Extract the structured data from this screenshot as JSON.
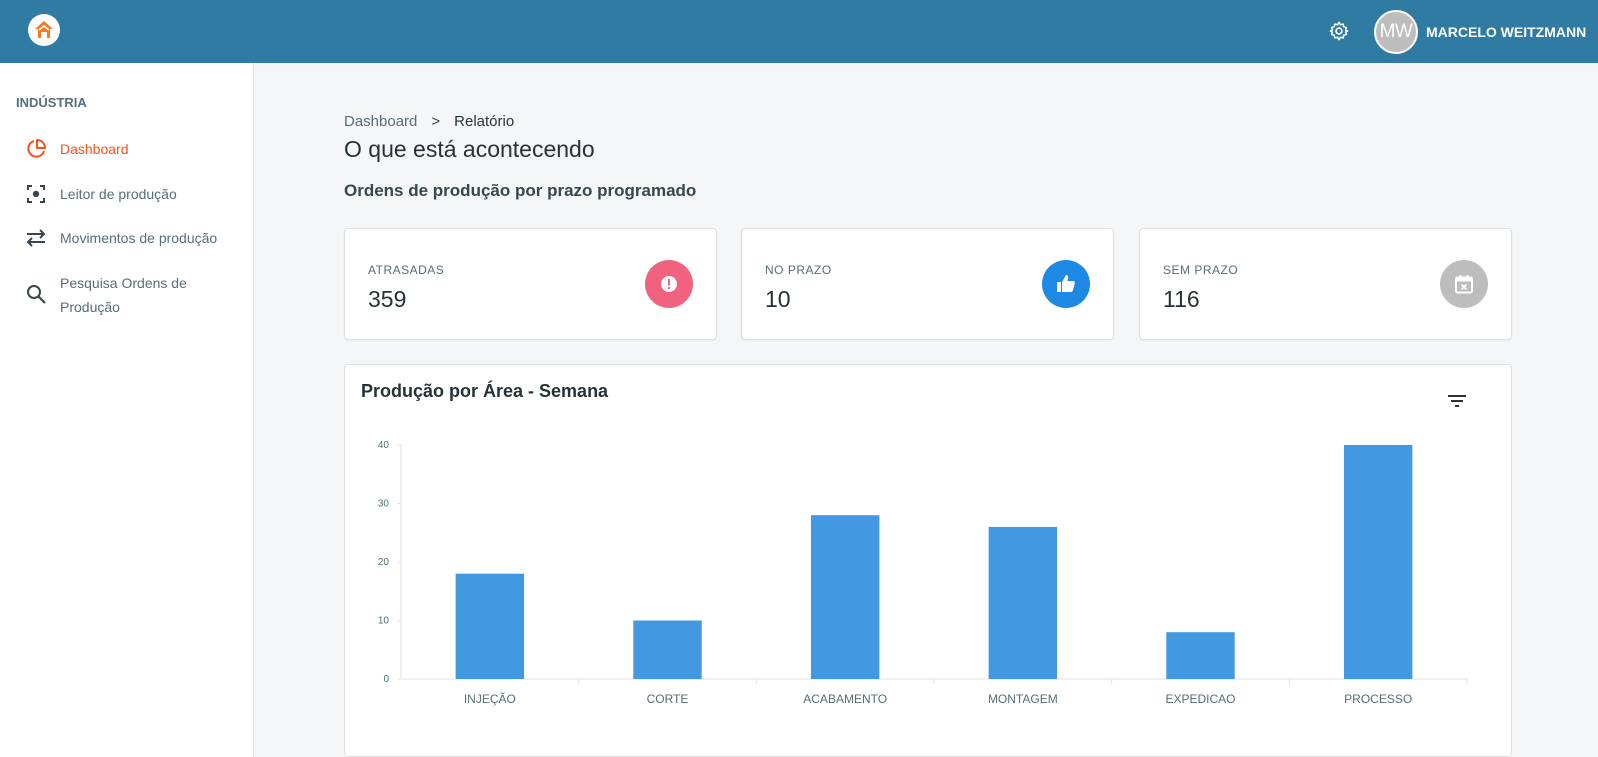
{
  "header": {
    "user_initials": "MW",
    "user_name": "MARCELO WEITZMANN"
  },
  "sidebar": {
    "section_title": "INDÚSTRIA",
    "items": [
      {
        "label": "Dashboard",
        "icon": "pie-chart-icon",
        "active": true
      },
      {
        "label": "Leitor de produção",
        "icon": "scan-icon",
        "active": false
      },
      {
        "label": "Movimentos de produção",
        "icon": "swap-arrows-icon",
        "active": false
      },
      {
        "label": "Pesquisa Ordens de Produção",
        "icon": "search-icon",
        "active": false
      }
    ]
  },
  "breadcrumb": {
    "root": "Dashboard",
    "separator": ">",
    "current": "Relatório"
  },
  "page_title": "O que está acontecendo",
  "section_subtitle": "Ordens de produção por prazo programado",
  "cards": [
    {
      "label": "ATRASADAS",
      "value": "359",
      "icon": "alert-icon",
      "color": "#f0627e"
    },
    {
      "label": "NO PRAZO",
      "value": "10",
      "icon": "thumbs-up-icon",
      "color": "#1e88e5"
    },
    {
      "label": "SEM PRAZO",
      "value": "116",
      "icon": "calendar-x-icon",
      "color": "#bdbdbd"
    }
  ],
  "colors": {
    "topbar": "#2f7ba3",
    "accent": "#f4511e",
    "bar": "#4299e1"
  },
  "chart_data": {
    "type": "bar",
    "title": "Produção por Área - Semana",
    "categories": [
      "INJEÇÃO",
      "CORTE",
      "ACABAMENTO",
      "MONTAGEM",
      "EXPEDICAO",
      "PROCESSO"
    ],
    "values": [
      18,
      10,
      28,
      26,
      8,
      40
    ],
    "ylim": [
      0,
      40
    ],
    "yticks": [
      0,
      10,
      20,
      30,
      40
    ],
    "grid": false,
    "legend": "none"
  }
}
